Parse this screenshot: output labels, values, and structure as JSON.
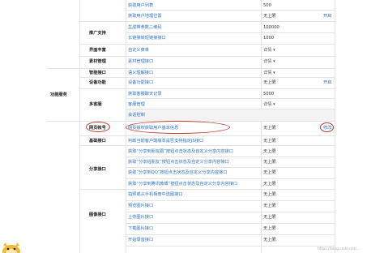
{
  "top_rows": [
    {
      "api": "获取用户列表",
      "quota": "500",
      "action": ""
    },
    {
      "api": "获取用户地理位置",
      "quota": "无上限",
      "action": "开启"
    }
  ],
  "promotion": {
    "label": "推广支持",
    "rows": [
      {
        "api": "生成带参数二维码",
        "quota": "100000",
        "action": ""
      },
      {
        "api": "长链接转短链接接口",
        "quota": "1000",
        "action": ""
      }
    ]
  },
  "ui_enrich": {
    "label": "界面丰富",
    "api": "自定义菜单",
    "quota": "详情",
    "action": ""
  },
  "material": {
    "label": "素材管理",
    "api": "素材管理接口",
    "quota": "详情",
    "action": ""
  },
  "section_label": "功能服务",
  "smart": {
    "label": "智能接口",
    "api": "语义理解接口",
    "quota": "详情",
    "action": ""
  },
  "device": {
    "label": "设备功能",
    "api": "设备功能接口",
    "quota": "无上限",
    "action": "开启"
  },
  "multi_cs": {
    "label": "多客服",
    "rows": [
      {
        "api": "获取客服聊天记录",
        "quota": "5000",
        "action": ""
      },
      {
        "api": "客服管理",
        "quota": "详情",
        "action": ""
      },
      {
        "api": "会话控制",
        "quota": "",
        "action": ""
      }
    ]
  },
  "web_auth": {
    "label": "网页帐号",
    "api": "网页授权获取用户基本信息",
    "quota": "无上限",
    "action": "修改"
  },
  "basic_iface": {
    "label": "基础接口",
    "api": "判断当前客户端版本是否支持指定JS接口",
    "quota": "无上限",
    "action": ""
  },
  "share": {
    "label": "分享接口",
    "rows": [
      {
        "api": "获取“分享到朋友圈”按钮点击状态及自定义分享内容接口",
        "quota": "无上限",
        "action": ""
      },
      {
        "api": "获取“分享给朋友”按钮点击状态及自定义分享内容接口",
        "quota": "无上限",
        "action": ""
      },
      {
        "api": "获取“分享到QQ”按钮点击状态及自定义分享内容接口",
        "quota": "无上限",
        "action": ""
      },
      {
        "api": "获取“分享到腾讯微博”按钮点击状态及自定义分享内容接口",
        "quota": "无上限",
        "action": ""
      }
    ]
  },
  "image": {
    "label": "图像接口",
    "rows": [
      {
        "api": "拍照或从手机相册中选图接口",
        "quota": "无上限",
        "action": ""
      },
      {
        "api": "预览图片接口",
        "quota": "无上限",
        "action": ""
      },
      {
        "api": "上传图片接口",
        "quota": "无上限",
        "action": ""
      },
      {
        "api": "下载图片接口",
        "quota": "无上限",
        "action": ""
      },
      {
        "api": "开始录音接口",
        "quota": "无上限",
        "action": ""
      }
    ]
  },
  "watermark": "https://blog.csdn.net/..."
}
